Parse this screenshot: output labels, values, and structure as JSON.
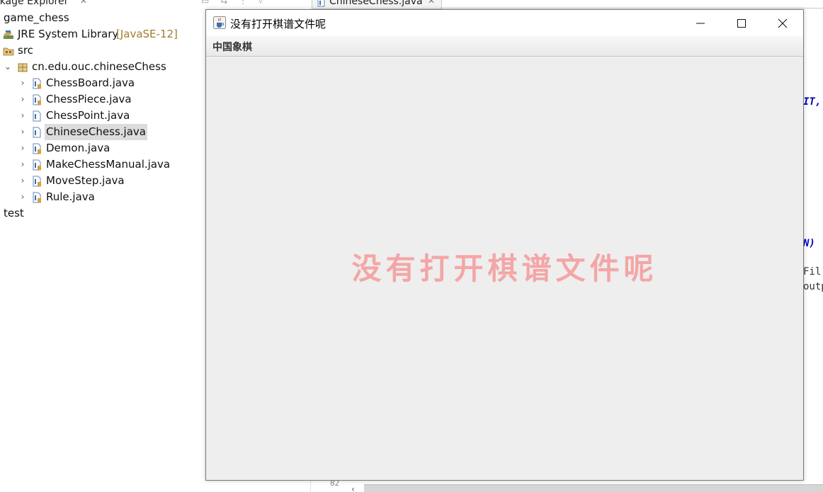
{
  "package_explorer": {
    "tab_label": "ckage Explorer",
    "close_glyph": "✕",
    "items": [
      {
        "label": "game_chess",
        "icon": "project-icon"
      },
      {
        "label": "JRE System Library",
        "decoration": "[JavaSE-12]",
        "icon": "library-icon"
      },
      {
        "label": "src",
        "icon": "source-folder-icon"
      },
      {
        "label": "cn.edu.ouc.chineseChess",
        "icon": "package-icon",
        "expanded": true
      },
      {
        "label": "ChessBoard.java",
        "icon": "java-file-icon"
      },
      {
        "label": "ChessPiece.java",
        "icon": "java-file-icon"
      },
      {
        "label": "ChessPoint.java",
        "icon": "java-file-icon"
      },
      {
        "label": "ChineseChess.java",
        "icon": "java-file-icon",
        "selected": true
      },
      {
        "label": "Demon.java",
        "icon": "java-file-icon"
      },
      {
        "label": "MakeChessManual.java",
        "icon": "java-file-icon"
      },
      {
        "label": "MoveStep.java",
        "icon": "java-file-icon"
      },
      {
        "label": "Rule.java",
        "icon": "java-file-icon"
      },
      {
        "label": "test",
        "icon": "folder-icon"
      }
    ]
  },
  "editor": {
    "tab_label": "ChineseChess.java",
    "close_glyph": "✕",
    "code_fragments": [
      "IT,",
      "N)",
      "Fil",
      "outp"
    ],
    "line_number": "82"
  },
  "dialog": {
    "title": "没有打开棋谱文件呢",
    "menu": [
      "中国象棋"
    ],
    "message": "没有打开棋谱文件呢",
    "colors": {
      "message": "#f4a6a6",
      "content_background": "#eeeeee"
    }
  }
}
